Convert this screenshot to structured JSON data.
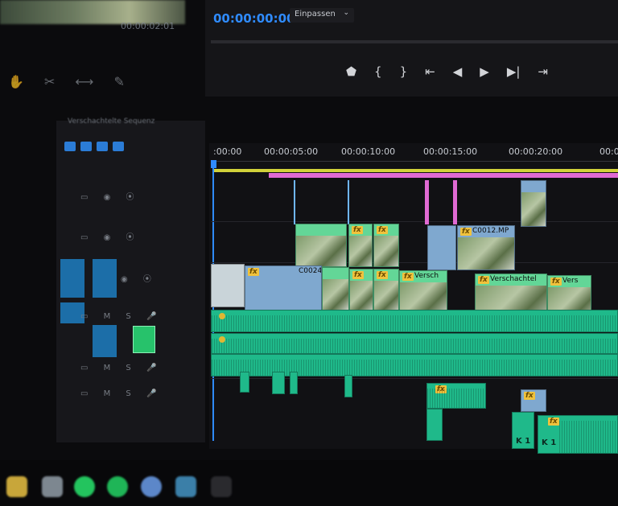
{
  "program_monitor": {
    "left_timecode": "00:00:02:01"
  },
  "timeline_header": {
    "timecode": "00:00:00:00",
    "zoom_label": "Einpassen",
    "transport_icons": [
      "marker-icon",
      "in-point-icon",
      "out-point-icon",
      "go-to-in-icon",
      "step-back-icon",
      "play-icon",
      "step-forward-icon",
      "go-to-out-icon"
    ]
  },
  "sequence": {
    "name": "Verschachtelte Sequenz"
  },
  "ruler": {
    "ticks": [
      {
        "label": ":00:00"
      },
      {
        "label": "00:00:05:00"
      },
      {
        "label": "00:00:10:00"
      },
      {
        "label": "00:00:15:00"
      },
      {
        "label": "00:00:20:00"
      },
      {
        "label": "00:0"
      }
    ]
  },
  "clips": {
    "c0024": "C0024",
    "c0012": "C0012.MP",
    "nested_a": "Versch",
    "nested_b": "Verschachtel",
    "nested_c": "Vers",
    "fx": "fx",
    "k1": "K 1",
    "k1b": "K 1"
  },
  "colors": {
    "accent_blue": "#2f8bff",
    "workarea_yellow": "#d2d23a",
    "inout_pink": "#e06ad3",
    "video_clip": "#7fa8cf",
    "nested_clip": "#63d697",
    "audio_clip": "#1fb98a"
  }
}
